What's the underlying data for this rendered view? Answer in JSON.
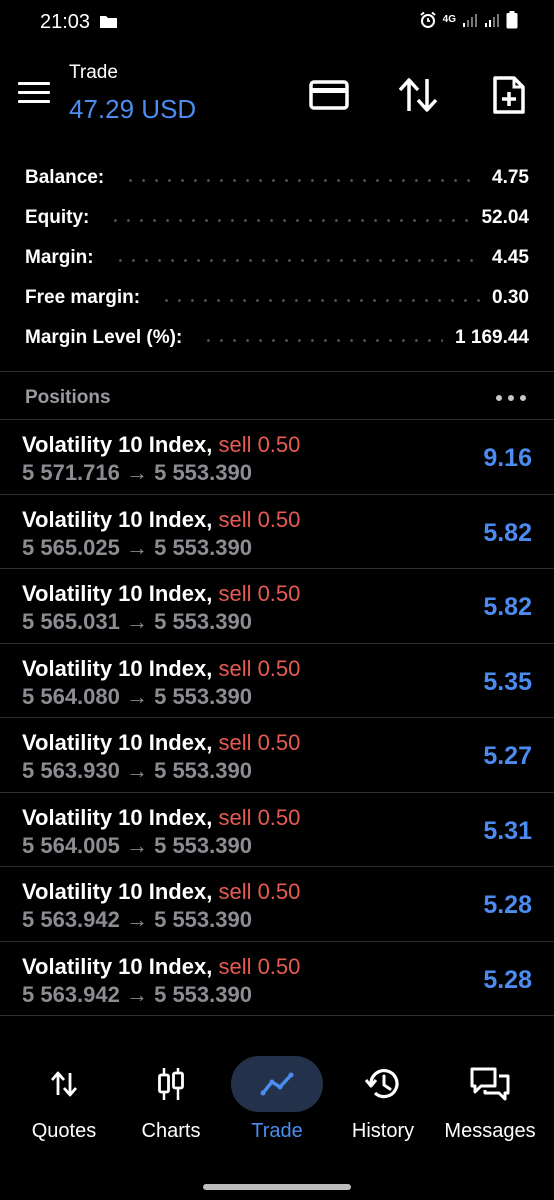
{
  "status_bar": {
    "time": "21:03",
    "network": "4G"
  },
  "app_bar": {
    "title": "Trade",
    "subtitle": "47.29 USD",
    "icons": [
      "menu-icon",
      "card-icon",
      "sort-arrows-icon",
      "new-order-icon"
    ]
  },
  "account": [
    {
      "label": "Balance:",
      "value": "4.75"
    },
    {
      "label": "Equity:",
      "value": "52.04"
    },
    {
      "label": "Margin:",
      "value": "4.45"
    },
    {
      "label": "Free margin:",
      "value": "0.30"
    },
    {
      "label": "Margin Level (%):",
      "value": "1 169.44"
    }
  ],
  "positions_section": {
    "title": "Positions",
    "more_icon": "more-dots-icon"
  },
  "positions": [
    {
      "symbol": "Volatility 10 Index,",
      "side": "sell 0.50",
      "prices": "5 571.716 → 5 553.390",
      "profit": "9.16"
    },
    {
      "symbol": "Volatility 10 Index,",
      "side": "sell 0.50",
      "prices": "5 565.025 → 5 553.390",
      "profit": "5.82"
    },
    {
      "symbol": "Volatility 10 Index,",
      "side": "sell 0.50",
      "prices": "5 565.031 → 5 553.390",
      "profit": "5.82"
    },
    {
      "symbol": "Volatility 10 Index,",
      "side": "sell 0.50",
      "prices": "5 564.080 → 5 553.390",
      "profit": "5.35"
    },
    {
      "symbol": "Volatility 10 Index,",
      "side": "sell 0.50",
      "prices": "5 563.930 → 5 553.390",
      "profit": "5.27"
    },
    {
      "symbol": "Volatility 10 Index,",
      "side": "sell 0.50",
      "prices": "5 564.005 → 5 553.390",
      "profit": "5.31"
    },
    {
      "symbol": "Volatility 10 Index,",
      "side": "sell 0.50",
      "prices": "5 563.942 → 5 553.390",
      "profit": "5.28"
    },
    {
      "symbol": "Volatility 10 Index,",
      "side": "sell 0.50",
      "prices": "5 563.942 → 5 553.390",
      "profit": "5.28"
    }
  ],
  "bottom_nav": {
    "items": [
      {
        "label": "Quotes",
        "icon": "quotes-arrows-icon",
        "active": false
      },
      {
        "label": "Charts",
        "icon": "candlestick-icon",
        "active": false
      },
      {
        "label": "Trade",
        "icon": "trend-line-icon",
        "active": true
      },
      {
        "label": "History",
        "icon": "history-clock-icon",
        "active": false
      },
      {
        "label": "Messages",
        "icon": "chat-bubbles-icon",
        "active": false
      }
    ]
  },
  "colors": {
    "accent": "#4c8cf0",
    "sell": "#e85a54",
    "muted": "#8c8c92",
    "background": "#000000"
  }
}
